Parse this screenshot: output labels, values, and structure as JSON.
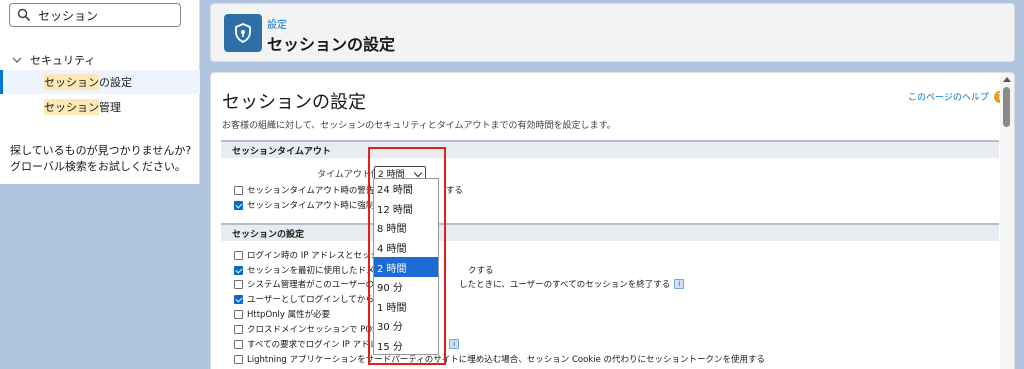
{
  "sidebar": {
    "search_value": "セッション",
    "parent": "セキュリティ",
    "items": [
      {
        "hl": "セッション",
        "rest": "の設定"
      },
      {
        "hl": "セッション",
        "rest": "管理"
      }
    ],
    "not_found_line1": "探しているものが見つかりませんか?",
    "not_found_line2": "グローバル検索をお試しください。"
  },
  "header": {
    "breadcrumb": "設定",
    "title": "セッションの設定"
  },
  "main": {
    "title": "セッションの設定",
    "help_link": "このページのヘルプ",
    "description": "お客様の組織に対して、セッションのセキュリティとタイムアウトまでの有効時間を設定します。",
    "timeout_section": "セッションタイムアウト",
    "timeout_label": "タイムアウト値",
    "timeout_selected": "2 時間",
    "timeout_options": [
      {
        "text": "セッションタイムアウト時の警告ポップ",
        "tail": "する",
        "checked": false
      },
      {
        "text": "セッションタイムアウト時に強制的にロ",
        "tail": "",
        "checked": true
      }
    ],
    "session_section": "セッションの設定",
    "session_options": [
      {
        "text": "ログイン時の IP アドレスとセッションを",
        "tail": "",
        "checked": false,
        "info": false
      },
      {
        "text": "セッションを最初に使用したドメインに",
        "tail": "クする",
        "checked": true,
        "info": false
      },
      {
        "text": "システム管理者がこのユーザーのパス",
        "tail": "したときに、ユーザーのすべてのセッションを終了する",
        "checked": false,
        "info": true
      },
      {
        "text": "ユーザーとしてログインしてから再ログイ",
        "tail": "",
        "checked": true,
        "info": false
      },
      {
        "text": "HttpOnly 属性が必要",
        "tail": "",
        "checked": false,
        "info": false
      },
      {
        "text": "クロスドメインセッションで POST 要求",
        "tail": "",
        "checked": false,
        "info": false
      },
      {
        "text": "すべての要求でログイン IP アドレスの",
        "tail": "",
        "checked": false,
        "info": true
      },
      {
        "text": "Lightning アプリケーションをサードパーティのサイトに埋め込む場合、セッション Cookie の代わりにセッショントークンを使用する",
        "tail": "",
        "checked": false,
        "info": false
      }
    ],
    "info_glyph": "i",
    "help_glyph": "?"
  },
  "dropdown": {
    "options": [
      "24 時間",
      "12 時間",
      "8 時間",
      "4 時間",
      "2 時間",
      "90 分",
      "1 時間",
      "30 分",
      "15 分"
    ],
    "selected_index": 4
  },
  "colors": {
    "accent": "#0176d3",
    "header_icon_bg": "#2e6fa8",
    "highlight_marker": "#e0201b",
    "search_highlight": "#fde9b5",
    "page_bg": "#b0c4df"
  }
}
